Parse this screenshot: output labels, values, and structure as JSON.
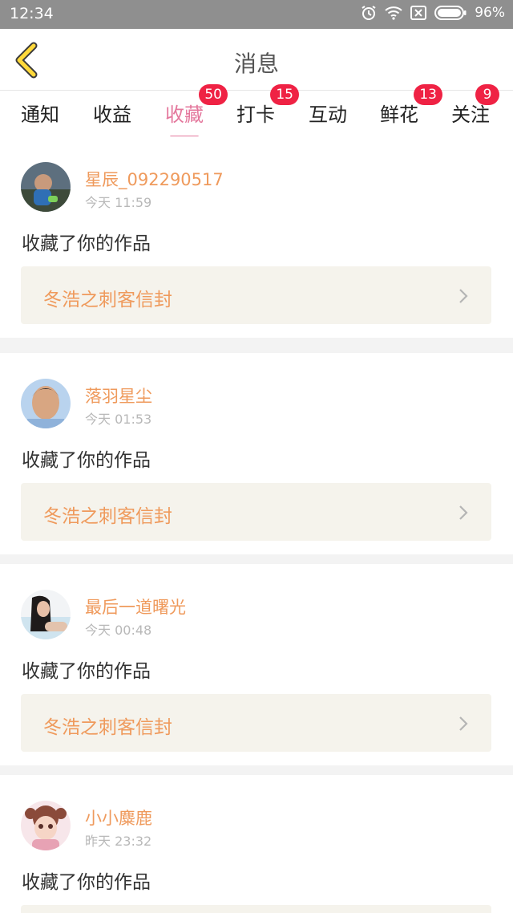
{
  "status_bar": {
    "time": "12:34",
    "battery": "96%"
  },
  "header": {
    "title": "消息"
  },
  "tabs": [
    {
      "label": "通知",
      "badge": ""
    },
    {
      "label": "收益",
      "badge": ""
    },
    {
      "label": "收藏",
      "badge": "50",
      "active": true
    },
    {
      "label": "打卡",
      "badge": "15"
    },
    {
      "label": "互动",
      "badge": ""
    },
    {
      "label": "鲜花",
      "badge": "13"
    },
    {
      "label": "关注",
      "badge": "9"
    }
  ],
  "feed": [
    {
      "user": "星辰_092290517",
      "time": "今天 11:59",
      "action": "收藏了你的作品",
      "work": "冬浩之刺客信封"
    },
    {
      "user": "落羽星尘",
      "time": "今天 01:53",
      "action": "收藏了你的作品",
      "work": "冬浩之刺客信封"
    },
    {
      "user": "最后一道曙光",
      "time": "今天 00:48",
      "action": "收藏了你的作品",
      "work": "冬浩之刺客信封"
    },
    {
      "user": "小小麋鹿",
      "time": "昨天 23:32",
      "action": "收藏了你的作品",
      "work": ""
    }
  ],
  "colors": {
    "accent": "#e4789d",
    "name": "#ef9a5c",
    "badge": "#ef2244"
  }
}
